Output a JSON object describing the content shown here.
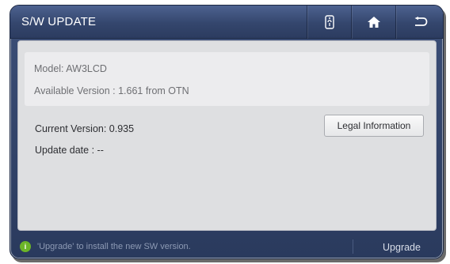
{
  "window": {
    "title": "S/W UPDATE"
  },
  "toolbar": {
    "remote_icon": "remote-control-icon",
    "home_icon": "home-icon",
    "back_icon": "return-arrow-icon"
  },
  "info": {
    "model": "Model: AW3LCD",
    "available_version": "Available Version : 1.661 from OTN"
  },
  "current": {
    "version": "Current Version: 0.935",
    "update_date": "Update date : --"
  },
  "buttons": {
    "legal_information": "Legal Information",
    "upgrade": "Upgrade"
  },
  "status": {
    "icon_glyph": "i",
    "message": "'Upgrade' to install the new SW version."
  },
  "colors": {
    "title_bar": "#34466d",
    "panel": "#dedfe1",
    "status_icon": "#6cb528"
  }
}
